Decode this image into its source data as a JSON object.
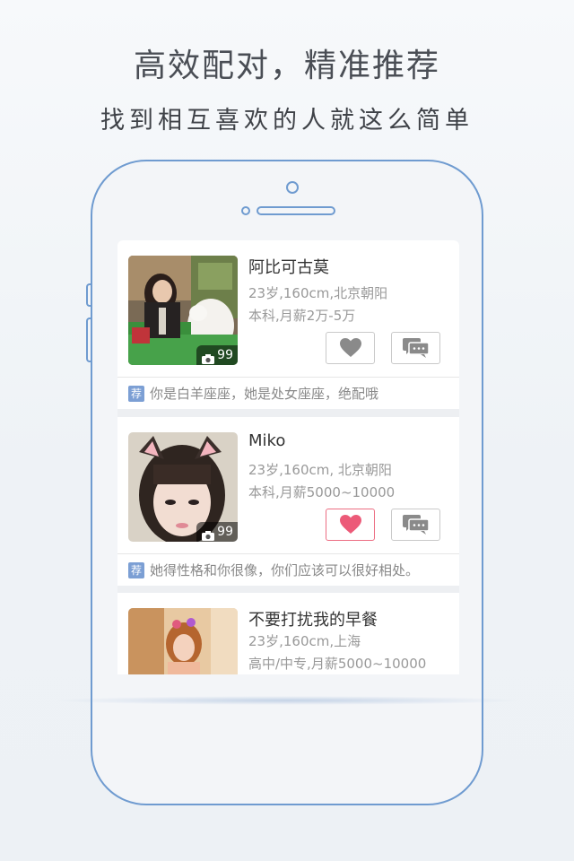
{
  "headline": "高效配对，精准推荐",
  "subline": "找到相互喜欢的人就这么简单",
  "profiles": [
    {
      "name": "阿比可古莫",
      "line1": "23岁,160cm,北京朝阳",
      "line2": "本科,月薪2万-5万",
      "photo_count": "99",
      "liked": false,
      "recommend_tag": "荐",
      "recommend_text": "你是白羊座座，她是处女座座，绝配哦"
    },
    {
      "name": "Miko",
      "line1": "23岁,160cm, 北京朝阳",
      "line2": "本科,月薪5000~10000",
      "photo_count": "99",
      "liked": true,
      "recommend_tag": "荐",
      "recommend_text": "她得性格和你很像，你们应该可以很好相处。"
    },
    {
      "name": "不要打扰我的早餐",
      "line1": "23岁,160cm,上海",
      "line2": "高中/中专,月薪5000~10000"
    }
  ],
  "icons": {
    "like": "heart-icon",
    "message": "chat-icon",
    "camera": "camera-icon"
  },
  "colors": {
    "phone_outline": "#6f9bd0",
    "like_active": "#ec5a78",
    "like_inactive": "#8a8a8a",
    "recommend_tag_bg": "#7c9fd4"
  }
}
